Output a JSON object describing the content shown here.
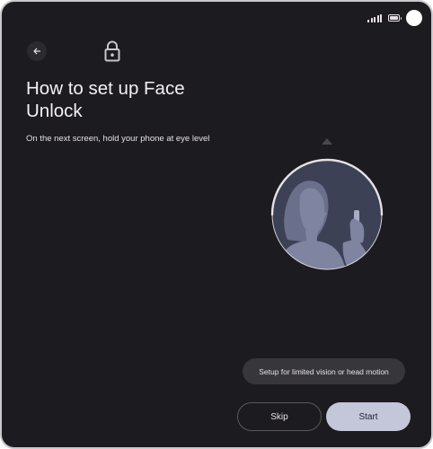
{
  "status_bar": {
    "signal_icon": "cellular-signal-icon",
    "battery_icon": "battery-full-icon"
  },
  "header": {
    "back_icon": "arrow-back-icon",
    "lock_icon": "lock-icon"
  },
  "content": {
    "title": "How to set up Face Unlock",
    "subtitle": "On the next screen, hold your phone at eye level"
  },
  "illustration": {
    "name": "face-scan-illustration"
  },
  "actions": {
    "accessibility_label": "Setup for limited vision or head motion",
    "skip_label": "Skip",
    "start_label": "Start"
  },
  "colors": {
    "background": "#1c1b1f",
    "primary_button": "#c4c6d9",
    "tonal_button": "#37363b",
    "illustration_bg": "#3d4155",
    "illustration_figure": "#7f84a0"
  }
}
